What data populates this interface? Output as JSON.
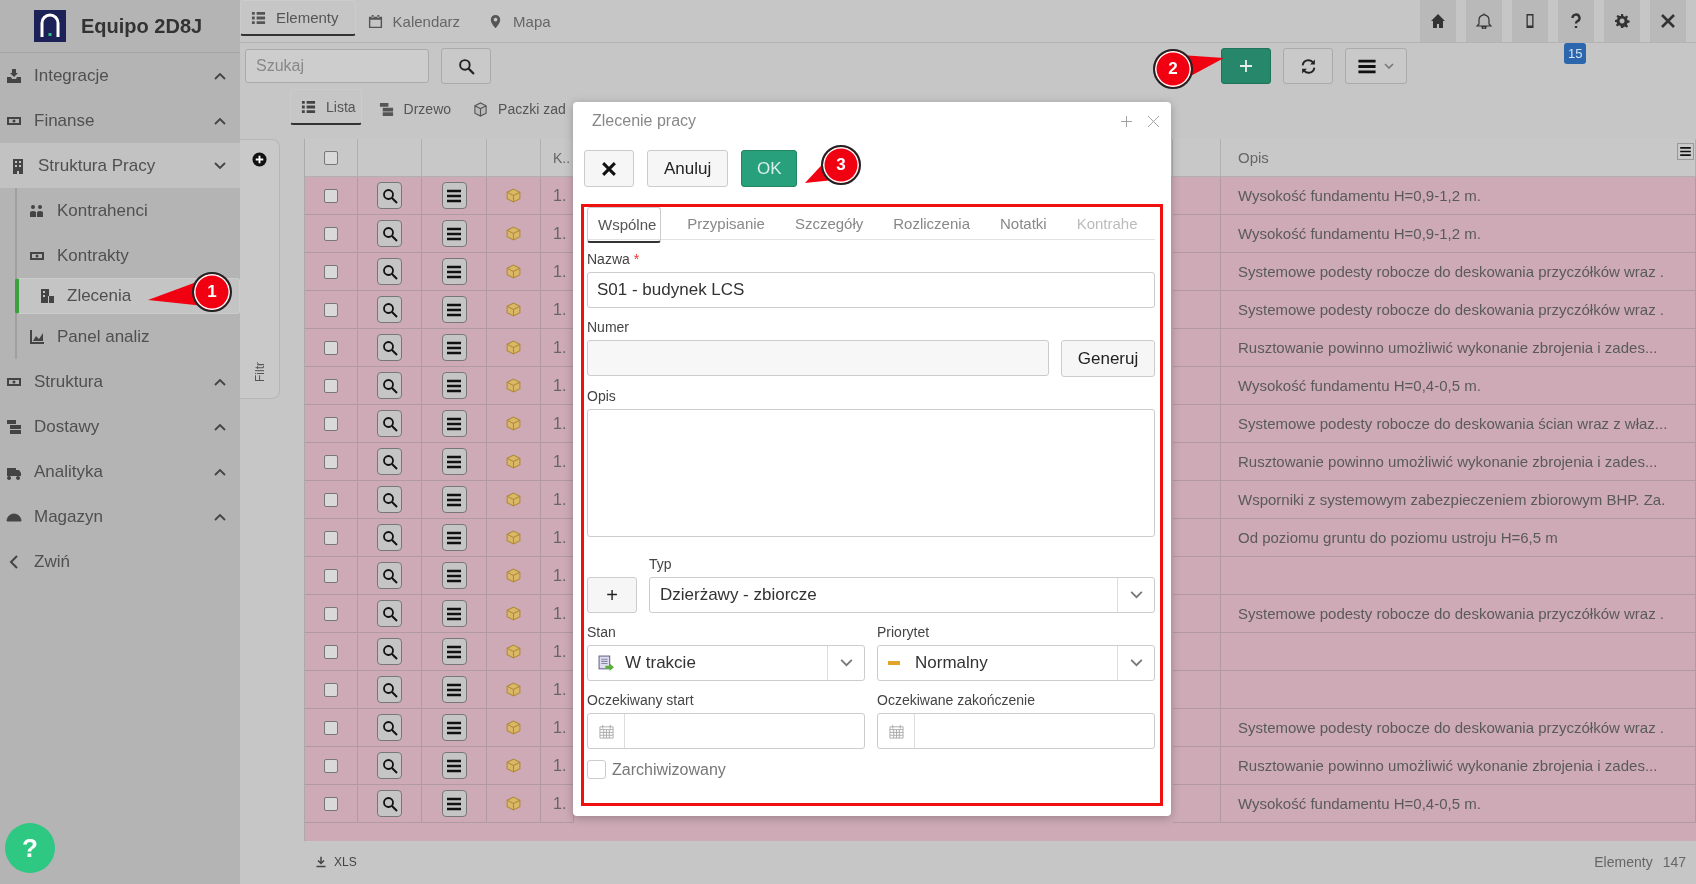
{
  "app": {
    "title": "Equipo 2D8J"
  },
  "sidebar": {
    "items": [
      {
        "label": "Integracje",
        "expanded": false
      },
      {
        "label": "Finanse",
        "expanded": false
      },
      {
        "label": "Struktura Pracy",
        "expanded": true,
        "children": [
          {
            "label": "Kontrahenci",
            "selected": false
          },
          {
            "label": "Kontrakty",
            "selected": false
          },
          {
            "label": "Zlecenia",
            "selected": true
          },
          {
            "label": "Panel analiz",
            "selected": false
          }
        ]
      },
      {
        "label": "Struktura",
        "expanded": false
      },
      {
        "label": "Dostawy",
        "expanded": false
      },
      {
        "label": "Analityka",
        "expanded": false
      },
      {
        "label": "Magazyn",
        "expanded": false
      }
    ],
    "collapse_label": "Zwiń",
    "help": "?"
  },
  "top_tabs": [
    {
      "label": "Elementy",
      "selected": true
    },
    {
      "label": "Kalendarz",
      "selected": false
    },
    {
      "label": "Mapa",
      "selected": false
    }
  ],
  "notifications_badge": "15",
  "search": {
    "placeholder": "Szukaj"
  },
  "view_tabs": [
    {
      "label": "Lista",
      "selected": true
    },
    {
      "label": "Drzewo",
      "selected": false
    },
    {
      "label": "Paczki zad",
      "selected": false
    }
  ],
  "filter_panel": {
    "label": "Filtr"
  },
  "table": {
    "columns": [
      "K..",
      "Opis"
    ],
    "all_checked": false,
    "rows": [
      {
        "checked": false,
        "k": "1.",
        "opis": "Wysokość fundamentu H=0,9-1,2 m."
      },
      {
        "checked": false,
        "k": "1.",
        "opis": "Wysokość fundamentu H=0,9-1,2 m."
      },
      {
        "checked": false,
        "k": "1.",
        "opis": "Systemowe podesty robocze do deskowania przyczółków wraz ."
      },
      {
        "checked": false,
        "k": "1.",
        "opis": "Systemowe podesty robocze do deskowania przyczółków wraz ."
      },
      {
        "checked": false,
        "k": "1.",
        "opis": "Rusztowanie powinno umożliwić wykonanie zbrojenia i zades..."
      },
      {
        "checked": false,
        "k": "1.",
        "opis": "Wysokość fundamentu H=0,4-0,5 m."
      },
      {
        "checked": false,
        "k": "1.",
        "opis": "Systemowe podesty robocze do deskowania ścian wraz z właz..."
      },
      {
        "checked": false,
        "k": "1.",
        "opis": "Rusztowanie powinno umożliwić wykonanie zbrojenia i zades..."
      },
      {
        "checked": false,
        "k": "1.",
        "opis": "Wsporniki z systemowym zabezpieczeniem zbiorowym BHP. Za."
      },
      {
        "checked": false,
        "k": "1.",
        "opis": "Od poziomu gruntu do poziomu ustroju H=6,5 m"
      },
      {
        "checked": false,
        "k": "1."
      },
      {
        "checked": false,
        "k": "1.",
        "opis": "Systemowe podesty robocze do deskowania przyczółków wraz ."
      },
      {
        "checked": false,
        "k": "1."
      },
      {
        "checked": false,
        "k": "1."
      },
      {
        "checked": false,
        "k": "1.",
        "opis": "Systemowe podesty robocze do deskowania przyczółków wraz ."
      },
      {
        "checked": false,
        "k": "1.",
        "opis": "Rusztowanie powinno umożliwić wykonanie zbrojenia i zades..."
      },
      {
        "checked": false,
        "k": "1.",
        "opis": "Wysokość fundamentu H=0,4-0,5 m."
      }
    ]
  },
  "footer": {
    "export": "XLS",
    "count_label": "Elementy",
    "count": "147"
  },
  "dialog": {
    "title": "Zlecenie pracy",
    "cancel": "Anuluj",
    "ok": "OK",
    "tabs": [
      {
        "label": "Wspólne",
        "selected": true
      },
      {
        "label": "Przypisanie",
        "selected": false
      },
      {
        "label": "Szczegóły",
        "selected": false
      },
      {
        "label": "Rozliczenia",
        "selected": false
      },
      {
        "label": "Notatki",
        "selected": false
      },
      {
        "label": "Kontrahe",
        "selected": false
      }
    ],
    "name_label": "Nazwa",
    "required_mark": "*",
    "name_value": "S01 - budynek LCS",
    "number_label": "Numer",
    "generate": "Generuj",
    "description_label": "Opis",
    "type_label": "Typ",
    "add": "+",
    "type_value": "Dzierżawy - zbiorcze",
    "state_label": "Stan",
    "state_value": "W trakcie",
    "priority_label": "Priorytet",
    "priority_value": "Normalny",
    "start_label": "Oczekiwany start",
    "end_label": "Oczekiwane zakończenie",
    "archived_label": "Zarchiwizowany",
    "archived": false
  },
  "annotations": [
    {
      "number": "1"
    },
    {
      "number": "2"
    },
    {
      "number": "3"
    }
  ]
}
